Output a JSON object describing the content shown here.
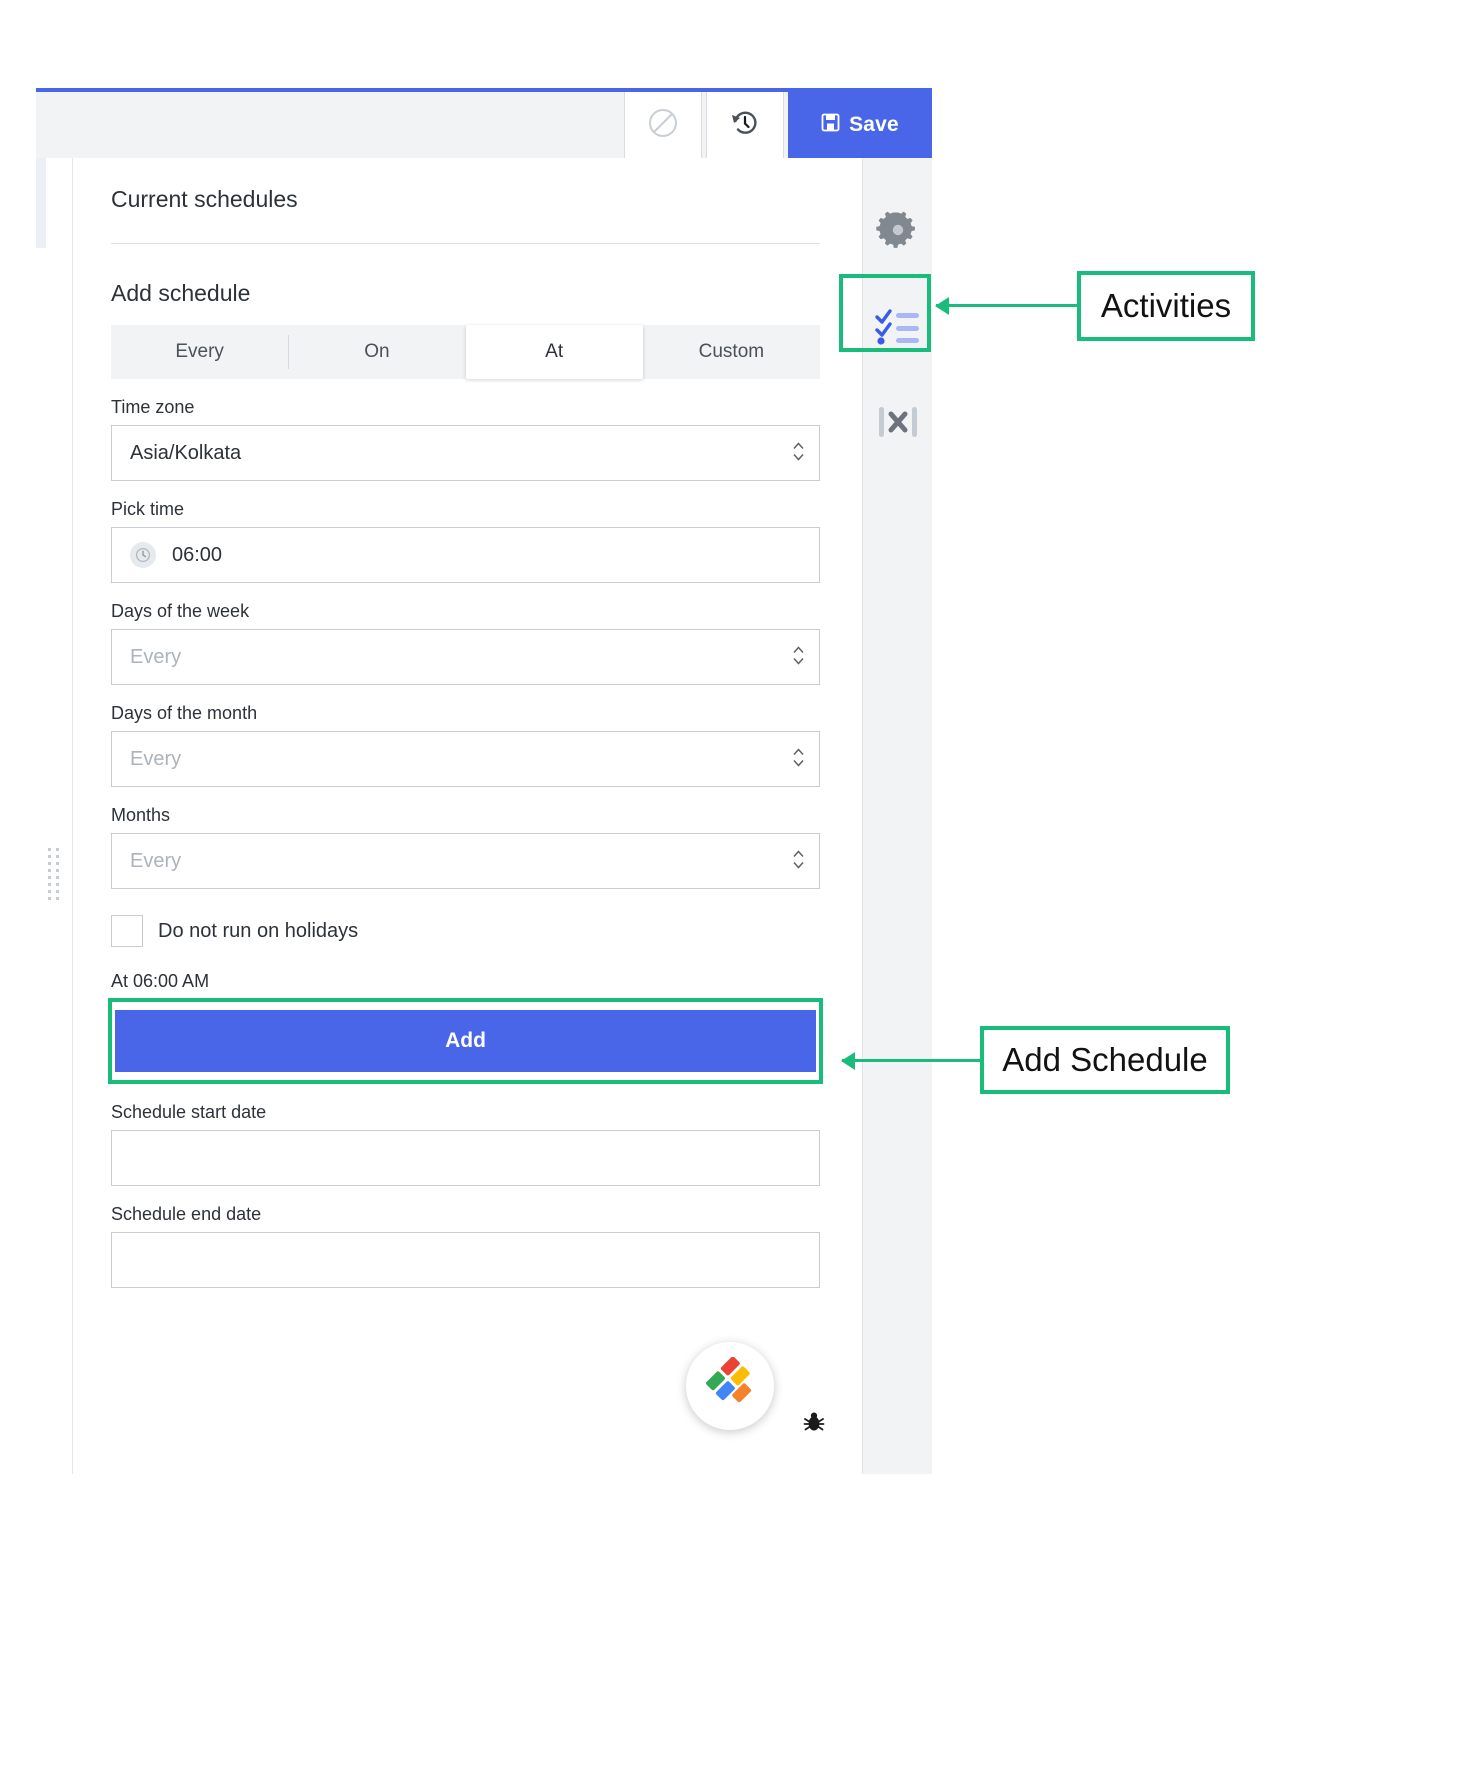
{
  "toolbar": {
    "disable_icon": "no-entry-icon",
    "history_icon": "history-revert-icon",
    "save_label": "Save",
    "save_icon": "save-disk-icon",
    "accent_color": "#4a66e8"
  },
  "panel": {
    "current_schedules_title": "Current schedules",
    "add_schedule_title": "Add schedule",
    "tabs": [
      {
        "label": "Every",
        "active": false
      },
      {
        "label": "On",
        "active": false
      },
      {
        "label": "At",
        "active": true
      },
      {
        "label": "Custom",
        "active": false
      }
    ],
    "fields": {
      "timezone": {
        "label": "Time zone",
        "value": "Asia/Kolkata",
        "placeholder": ""
      },
      "pick_time": {
        "label": "Pick time",
        "value": "06:00",
        "icon": "clock-icon"
      },
      "days_of_week": {
        "label": "Days of the week",
        "value": "",
        "placeholder": "Every"
      },
      "days_of_month": {
        "label": "Days of the month",
        "value": "",
        "placeholder": "Every"
      },
      "months": {
        "label": "Months",
        "value": "",
        "placeholder": "Every"
      },
      "schedule_start_date": {
        "label": "Schedule start date",
        "value": "",
        "placeholder": ""
      },
      "schedule_end_date": {
        "label": "Schedule end date",
        "value": "",
        "placeholder": ""
      }
    },
    "holidays_checkbox": {
      "label": "Do not run on holidays",
      "checked": false
    },
    "summary": "At 06:00 AM",
    "add_button_label": "Add",
    "stepper_glyph": "⌃⌄"
  },
  "right_rail": {
    "items": [
      {
        "name": "settings-gear-icon",
        "label": "Settings"
      },
      {
        "name": "activities-checklist-icon",
        "label": "Activities"
      },
      {
        "name": "collapse-panel-icon",
        "label": "Collapse"
      }
    ]
  },
  "footer": {
    "brand_badge": "brand-logo-icon",
    "bug_icon": "bug-icon"
  },
  "annotations": [
    {
      "id": "activities",
      "label": "Activities",
      "target": "activities-checklist-icon"
    },
    {
      "id": "add-schedule",
      "label": "Add Schedule",
      "target": "add-button"
    }
  ],
  "colors": {
    "accent": "#4a66e8",
    "highlight": "#1abc7b",
    "toolbar_bg": "#f1f3f5"
  }
}
